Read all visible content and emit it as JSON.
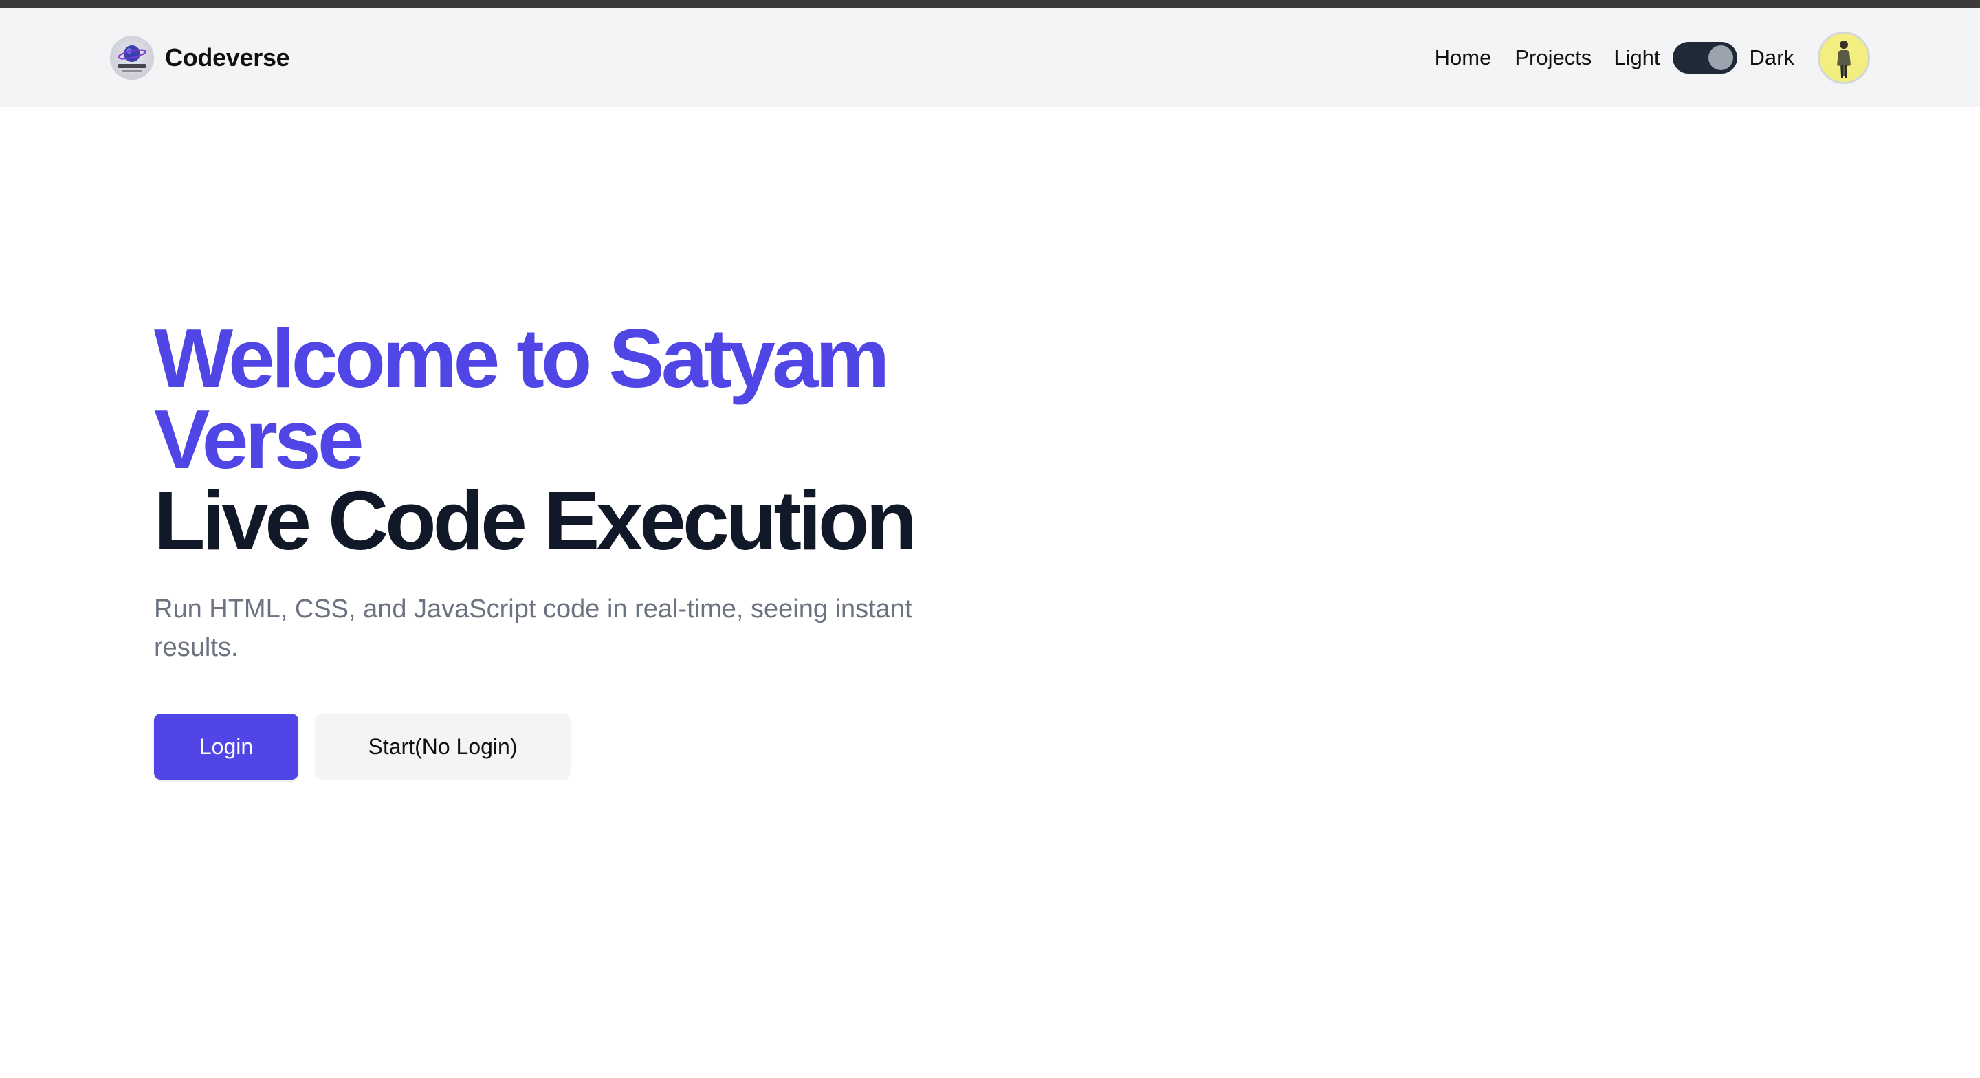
{
  "brand": {
    "name": "Codeverse",
    "logo_icon": "planet-logo-icon",
    "logo_text": "CodeVerse"
  },
  "nav": {
    "home": "Home",
    "projects": "Projects",
    "theme": {
      "light_label": "Light",
      "dark_label": "Dark",
      "enabled": true
    },
    "avatar_icon": "user-avatar-icon"
  },
  "hero": {
    "title_accent": "Welcome to Satyam Verse",
    "title_main": "Live Code Execution",
    "subtitle": "Run HTML, CSS, and JavaScript code in real-time, seeing instant results."
  },
  "actions": {
    "login": "Login",
    "start": "Start(No Login)"
  },
  "colors": {
    "accent": "#4f46e5",
    "heading": "#111827",
    "muted": "#6b7280",
    "navbar_bg": "#f3f4f6",
    "toggle_bg": "#1f2937",
    "avatar_bg": "#f2ee80"
  }
}
